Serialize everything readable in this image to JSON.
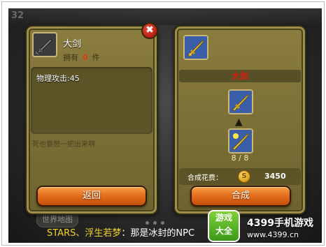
{
  "left_panel": {
    "item_name": "大剑",
    "own_prefix": "拥有",
    "own_count": "0",
    "own_suffix": "件",
    "stat": "物理攻击:45",
    "description": "死也要憋一把出来啊",
    "back_label": "返回",
    "icon": "broken-sword-icon"
  },
  "close_button": {
    "label": "✖",
    "icon": "close-icon"
  },
  "right_panel": {
    "target_name": "大剑",
    "icon": "golden-sword-icon",
    "arrow": "▲",
    "material_count": "8 / 8",
    "cost_label": "合成花费：",
    "coin_symbol": "S",
    "cost_value": "3450",
    "craft_label": "合成"
  },
  "background": {
    "hud_number": "32",
    "world_map": "世界地图"
  },
  "caption": {
    "highlight": "STARS、浮生若梦",
    "text": "：那是冰封的NPC"
  },
  "watermark": {
    "logo_text_1": "游戏",
    "logo_text_2": "大全",
    "brand": "4399手机游戏",
    "url": "www.4399.cn"
  },
  "colors": {
    "panel": "#7d7137",
    "button": "#e5701e",
    "rare_name": "#d91e0c",
    "zero_count": "#e23a12"
  }
}
